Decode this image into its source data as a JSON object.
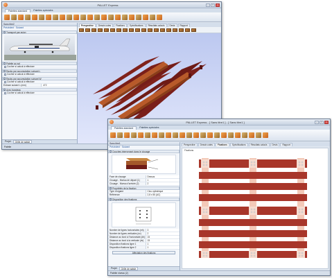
{
  "window1": {
    "title": "PALLET Express",
    "ribbon_tabs": [
      "Palettes standard",
      "Palettes spéciales"
    ],
    "panel_title": "Sans titre2",
    "nav": {
      "prev": "Précédent",
      "next": "Suivant"
    },
    "plane_caption": "Transport par avion",
    "sections": [
      {
        "label": "Palette au sol",
        "rows": [
          "Cocher si calcul à effectuer"
        ]
      },
      {
        "label": "Racks par accumulation suivant L",
        "rows": [
          "Cocher si calcul à effectuer"
        ]
      },
      {
        "label": "Racks par accumulation suivant W",
        "rows": [
          "Cocher si calcul à effectuer"
        ]
      },
      {
        "label": "Avec bandeau",
        "rows": [
          "Cocher si calcul à effectuer"
        ]
      }
    ],
    "field": {
      "label": "Entraxe suivant L (mm)",
      "value": "472"
    },
    "bottom_tabs": [
      "Projet",
      "Grille de saisie"
    ],
    "view_tabs": [
      "Perspective",
      "Dessin cotes",
      "Fixations",
      "Spécifications",
      "Résultats calculs",
      "Devis",
      "Rapport"
    ],
    "status": "Palette"
  },
  "window2": {
    "title": "PALLET Express - [ Sans titre1 ] - [ Sans titre1 ]",
    "ribbon_tabs": [
      "Palettes standard",
      "Palettes spéciales"
    ],
    "panel_title": "Sans titre1",
    "nav": {
      "prev": "Précédent",
      "next": "Suivant"
    },
    "section_couches": "Couches intervenant dans le clouage",
    "fields_a": [
      {
        "label": "Face de clouage",
        "value": "Dessus"
      },
      {
        "label": "Clouage - Niveau de départ (1)",
        "value": "1"
      },
      {
        "label": "Clouage - Niveau d'arrivée (2)",
        "value": "2"
      }
    ],
    "section_fixation": "Propriétés de la fixation",
    "fields_b": [
      {
        "label": "Type d'organe",
        "value": "Clou cylindrique"
      },
      {
        "label": "Référence",
        "value": "2,8 x 55 (AC)"
      }
    ],
    "section_disposition": "Disposition des fixations",
    "fields_c": [
      {
        "label": "Nombre de lignes horizontales (nh)",
        "value": "3"
      },
      {
        "label": "Nombre de lignes verticales (nv)",
        "value": "2"
      },
      {
        "label": "Distance au bord à l'horizontale (dh)",
        "value": "15"
      },
      {
        "label": "Distance au bord à la verticale (dv)",
        "value": "15"
      },
      {
        "label": "Disposition fixations ligne 1",
        "value": "1"
      },
      {
        "label": "Disposition fixations ligne 2",
        "value": "1"
      }
    ],
    "action_button": "Affectation des fixations",
    "bottom_tabs": [
      "Projet",
      "Grille de saisie"
    ],
    "view_tabs": [
      "Perspective",
      "Dessin cotes",
      "Fixations",
      "Spécifications",
      "Résultats calculs",
      "Devis",
      "Rapport"
    ],
    "plan_label": "Fixations",
    "status": "Palette niveau (2)"
  },
  "colors": {
    "wood_dark": "#7a1f1a",
    "wood_light": "#b85a2a",
    "viewport": "#c6d0f3",
    "plank": "#a8362a"
  }
}
